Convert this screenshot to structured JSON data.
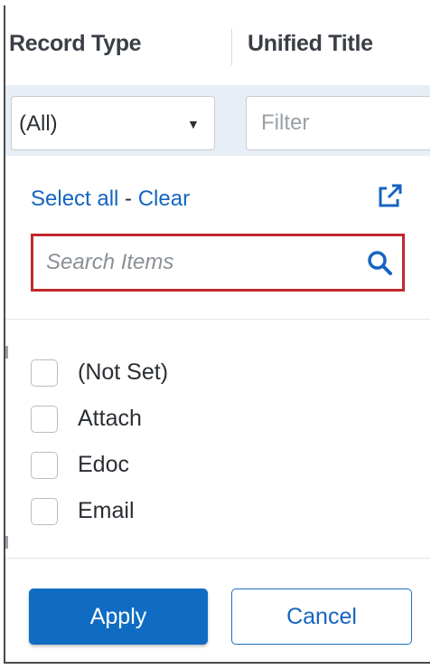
{
  "header": {
    "col1": "Record Type",
    "col2": "Unified Title"
  },
  "filter_row": {
    "select_value": "(All)",
    "caret": "▼",
    "filter_placeholder": "Filter"
  },
  "panel": {
    "select_all": "Select all",
    "separator": " - ",
    "clear": "Clear",
    "popout_icon": "external-link-icon",
    "search_placeholder": "Search Items",
    "search_icon": "search-icon",
    "items": [
      {
        "label": "(Not Set)",
        "checked": false
      },
      {
        "label": "Attach",
        "checked": false
      },
      {
        "label": "Edoc",
        "checked": false
      },
      {
        "label": "Email",
        "checked": false
      }
    ],
    "apply_label": "Apply",
    "cancel_label": "Cancel"
  },
  "colors": {
    "accent": "#0f6cc2",
    "link": "#1565c0",
    "highlight_border": "#c0282c",
    "filter_row_bg": "#e8eef6"
  }
}
